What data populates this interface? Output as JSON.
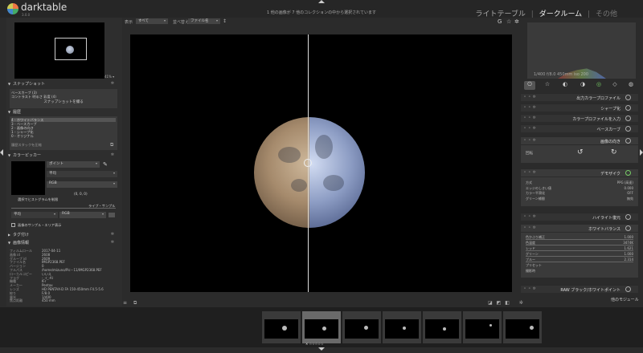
{
  "app": {
    "name": "darktable",
    "version": "3.0.0",
    "collection_status": "1 他の画像が 7 他のコレクションの中から選択されています"
  },
  "views": [
    "ライトテーブル",
    "ダークルーム",
    "その他"
  ],
  "views_sep": "|",
  "navigation": {
    "zoom": "41% ▾"
  },
  "left": {
    "snapshots": {
      "title": "スナップショット",
      "items": [
        "ベースカーブ (3)",
        "コントラスト 明るさ 彩度 (4)"
      ],
      "take_button": "スナップショットを撮る"
    },
    "history": {
      "title": "履歴",
      "items": [
        "4 - ホワイトバランス",
        "3 - ベースカーブ",
        "2 - 画像の向き",
        "1 - シャープ化",
        "0 - オリジナル"
      ],
      "compress_button": "履歴スタックを圧縮"
    },
    "colorpicker": {
      "title": "カラーピッカー",
      "mode": "ポイント",
      "stat": "平均",
      "space": "RGB",
      "values": "(0, 0, 0)",
      "restrict_label": "選択でヒストグラムを制限",
      "live_samples": "ライブ・サンプル",
      "area_stat": "平均",
      "area_space": "RGB",
      "display_area": "画像のサンプル・エリア表示"
    },
    "tagging": {
      "title": "タグ付け"
    },
    "image_info": {
      "title": "画像情報",
      "rows": [
        {
          "k": "フィルムロール",
          "v": "2017-04-11"
        },
        {
          "k": "画像 id",
          "v": "2608"
        },
        {
          "k": "グループ id",
          "v": "2609"
        },
        {
          "k": "ファイル名",
          "v": "IMGP2368.PEF"
        },
        {
          "k": "バージョン",
          "v": "0"
        },
        {
          "k": "フルパス",
          "v": "/home/mizuno/Pic···11/IMGP2368.PEF"
        },
        {
          "k": "ローカルコピー",
          "v": "いいえ"
        },
        {
          "k": "フラグ",
          "v": "-_-r_-Al"
        },
        {
          "k": "機種",
          "v": "K-r"
        },
        {
          "k": "メーカー",
          "v": "Pentax"
        },
        {
          "k": "レンズ",
          "v": "HD PENTAX-D FA 150-450mm F4.5-5.6"
        },
        {
          "k": "絞り",
          "v": "F/8.0"
        },
        {
          "k": "露光",
          "v": "1/400"
        },
        {
          "k": "焦点距離",
          "v": "450 mm"
        }
      ]
    }
  },
  "center_bar": {
    "show_label": "表示",
    "show_value": "すべて",
    "sort_label": "並べ替え",
    "sort_value": "ファイル名"
  },
  "right": {
    "histogram_info": "1/400 f/8.0 450mm iso 200",
    "module_tabs": [
      "⏻",
      "☆",
      "◐",
      "◑",
      "◎",
      "◇",
      "◍"
    ],
    "modules": [
      {
        "name": "出力カラープロファイル"
      },
      {
        "name": "シャープ化"
      },
      {
        "name": "カラープロファイルを入力"
      },
      {
        "name": "ベースカーブ"
      },
      {
        "name": "画像の向き"
      }
    ],
    "orientation": {
      "label": "回転"
    },
    "demosaic": {
      "name": "デモザイク",
      "params": [
        {
          "k": "方式",
          "v": "PPG (高速)"
        },
        {
          "k": "エッジのしきい値",
          "v": "0.000"
        },
        {
          "k": "カラー平滑化",
          "v": "OFF"
        },
        {
          "k": "グリーン補間",
          "v": "無効"
        }
      ]
    },
    "highlight": {
      "name": "ハイライト復元"
    },
    "whitebalance": {
      "name": "ホワイトバランス",
      "params": [
        {
          "k": "色かぶり補正",
          "v": "1.000"
        },
        {
          "k": "色温度",
          "v": "3474K"
        },
        {
          "k": "レッド",
          "v": "1.621"
        },
        {
          "k": "グリーン",
          "v": "1.000"
        },
        {
          "k": "ブルー",
          "v": "2.314"
        },
        {
          "k": "プリセット",
          "v": ""
        },
        {
          "k": "撮影時",
          "v": ""
        }
      ]
    },
    "raw_black": {
      "name": "RAW ブラック/ホワイトポイント"
    },
    "other_modules": "他のモジュール"
  },
  "filmstrip": {
    "count": 7,
    "stars": "✕ ☆☆☆☆☆"
  },
  "colors": {
    "background": "#2b2b2b",
    "panel": "#3a3a3a",
    "accent": "#dddddd"
  }
}
